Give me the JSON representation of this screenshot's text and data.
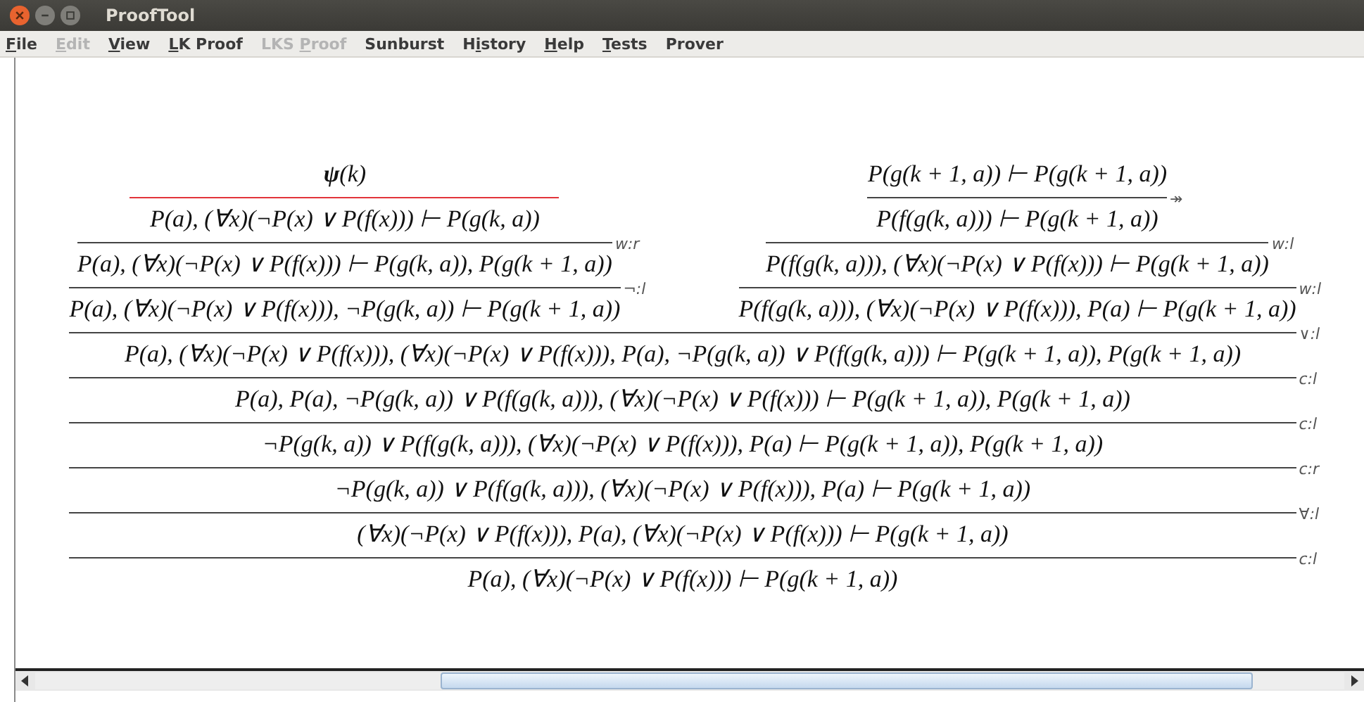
{
  "window": {
    "title": "ProofTool"
  },
  "menu": [
    {
      "mnemonic": "F",
      "after": "ile",
      "disabled": false
    },
    {
      "mnemonic": "E",
      "after": "dit",
      "disabled": true
    },
    {
      "mnemonic": "V",
      "after": "iew",
      "disabled": false
    },
    {
      "mnemonic": "L",
      "after": "K Proof",
      "disabled": false
    },
    {
      "before": "LKS ",
      "mnemonic": "P",
      "after": "roof",
      "disabled": true
    },
    {
      "before": "Sunburst",
      "disabled": false
    },
    {
      "before": "H",
      "mnemonic": "i",
      "after": "story",
      "disabled": false
    },
    {
      "mnemonic": "H",
      "after": "elp",
      "disabled": false
    },
    {
      "mnemonic": "T",
      "after": "ests",
      "disabled": false
    },
    {
      "before": "Prover",
      "disabled": false
    }
  ],
  "proof": {
    "sequent": "P(a), (∀x)(¬P(x) ∨ P(f(x))) ⊢ P(g(k + 1, a))",
    "rule": "c:l",
    "link": false,
    "children": [
      {
        "sequent": "(∀x)(¬P(x) ∨ P(f(x))), P(a), (∀x)(¬P(x) ∨ P(f(x))) ⊢ P(g(k + 1, a))",
        "rule": "∀:l",
        "link": false,
        "children": [
          {
            "sequent": "¬P(g(k, a)) ∨ P(f(g(k, a))), (∀x)(¬P(x) ∨ P(f(x))), P(a) ⊢ P(g(k + 1, a))",
            "rule": "c:r",
            "link": false,
            "children": [
              {
                "sequent": "¬P(g(k, a)) ∨ P(f(g(k, a))), (∀x)(¬P(x) ∨ P(f(x))), P(a) ⊢ P(g(k + 1, a)), P(g(k + 1, a))",
                "rule": "c:l",
                "link": false,
                "children": [
                  {
                    "sequent": "P(a), P(a), ¬P(g(k, a)) ∨ P(f(g(k, a))), (∀x)(¬P(x) ∨ P(f(x))) ⊢ P(g(k + 1, a)), P(g(k + 1, a))",
                    "rule": "c:l",
                    "link": false,
                    "children": [
                      {
                        "sequent": "P(a), (∀x)(¬P(x) ∨ P(f(x))), (∀x)(¬P(x) ∨ P(f(x))), P(a), ¬P(g(k, a)) ∨ P(f(g(k, a))) ⊢ P(g(k + 1, a)), P(g(k + 1, a))",
                        "rule": "∨:l",
                        "link": false,
                        "children": [
                          {
                            "sequent": "P(a), (∀x)(¬P(x) ∨ P(f(x))), ¬P(g(k, a)) ⊢ P(g(k + 1, a))",
                            "rule": "¬:l",
                            "link": false,
                            "children": [
                              {
                                "sequent": "P(a), (∀x)(¬P(x) ∨ P(f(x))) ⊢ P(g(k, a)), P(g(k + 1, a))",
                                "rule": "w:r",
                                "link": false,
                                "children": [
                                  {
                                    "sequent": "P(a), (∀x)(¬P(x) ∨ P(f(x))) ⊢ P(g(k, a))",
                                    "link": true,
                                    "children": [
                                      {
                                        "sequent": "**ψ**(k)"
                                      }
                                    ]
                                  }
                                ]
                              }
                            ]
                          },
                          {
                            "sequent": "P(f(g(k, a))), (∀x)(¬P(x) ∨ P(f(x))), P(a) ⊢ P(g(k + 1, a))",
                            "rule": "w:l",
                            "link": false,
                            "children": [
                              {
                                "sequent": "P(f(g(k, a))), (∀x)(¬P(x) ∨ P(f(x))) ⊢ P(g(k + 1, a))",
                                "rule": "w:l",
                                "link": false,
                                "children": [
                                  {
                                    "sequent": "P(f(g(k, a))) ⊢ P(g(k + 1, a))",
                                    "rule": "↠",
                                    "link": false,
                                    "children": [
                                      {
                                        "sequent": "P(g(k + 1, a)) ⊢ P(g(k + 1, a))"
                                      }
                                    ]
                                  }
                                ]
                              }
                            ]
                          }
                        ]
                      }
                    ]
                  }
                ]
              }
            ]
          }
        ]
      }
    ]
  }
}
